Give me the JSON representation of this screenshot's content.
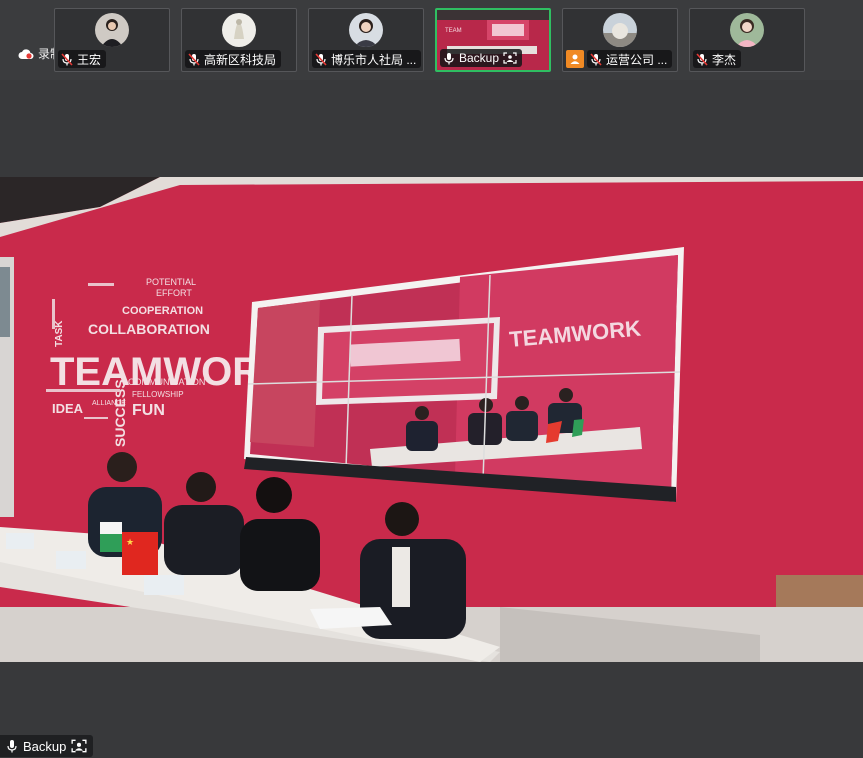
{
  "recording": {
    "label": "录制中"
  },
  "participants": [
    {
      "name": "王宏"
    },
    {
      "name": "高新区科技局"
    },
    {
      "name": "博乐市人社局 ..."
    },
    {
      "name": "Backup"
    },
    {
      "name": "运营公司 ..."
    },
    {
      "name": "李杰"
    }
  ],
  "main_video": {
    "wall_words": [
      "TEAMWORK",
      "COLLABORATION",
      "COOPERATION",
      "POTENTIAL",
      "EFFORT",
      "COMMUNICATION",
      "FELLOWSHIP",
      "FUN",
      "SUCCESS",
      "IDEA",
      "TASK",
      "ALLIANCE"
    ]
  },
  "self_view": {
    "name": "Backup"
  },
  "colors": {
    "active_border": "#2fbf62",
    "wall_red": "#c92a4b",
    "toolbar_bg": "#3b3c3e"
  }
}
